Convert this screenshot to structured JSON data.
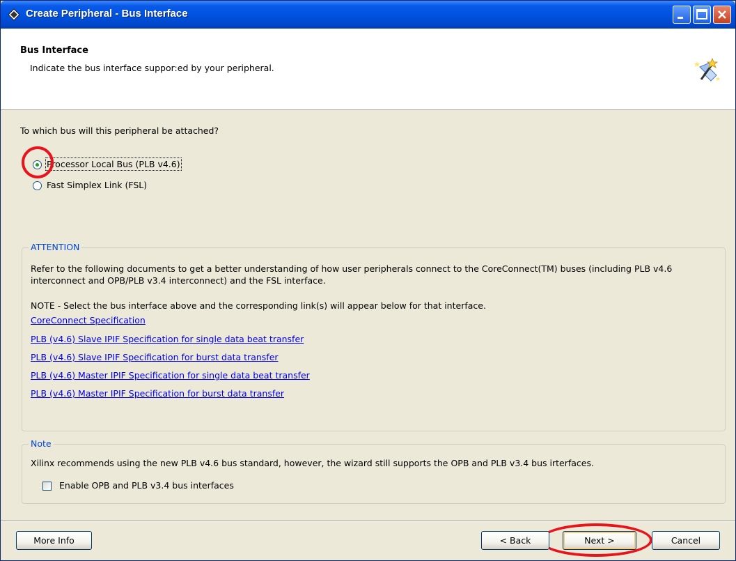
{
  "window": {
    "title": "Create Peripheral - Bus Interface"
  },
  "header": {
    "title": "Bus Interface",
    "subtitle": "Indicate the bus interface suppor:ed by your peripheral."
  },
  "question": "To which bus will this peripheral be attached?",
  "bus_options": [
    {
      "label": "Processor Local Bus (PLB v4.6)",
      "selected": true
    },
    {
      "label": "Fast Simplex Link (FSL)",
      "selected": false
    }
  ],
  "attention": {
    "title": "ATTENTION",
    "text": "Refer to the following documents to get a better understanding of how user peripherals connect to the CoreConnect(TM) buses (including PLB v4.6 interconnect and OPB/PLB v3.4 interconnect) and the FSL interface.",
    "note": "NOTE - Select the bus interface above and the corresponding link(s) will appear below for that interface.",
    "links": [
      "CoreConnect Specification",
      "PLB (v4.6) Slave IPIF Specification for single data beat transfer",
      "PLB (v4.6) Slave IPIF Specification for burst data transfer",
      "PLB (v4.6) Master IPIF Specification for single data beat transfer",
      "PLB (v4.6) Master IPIF Specification for burst data transfer"
    ]
  },
  "note_group": {
    "title": "Note",
    "text": "Xilinx recommends using the new PLB v4.6 bus standard, however, the wizard still supports the OPB and PLB v3.4 bus irterfaces.",
    "checkbox_label": "Enable OPB and PLB v3.4 bus interfaces",
    "checkbox_checked": false
  },
  "buttons": {
    "more_info": "More Info",
    "back": "< Back",
    "next": "Next >",
    "cancel": "Cancel"
  },
  "colors": {
    "titlebar": "#0052e0",
    "group_title": "#0046d5",
    "link": "#0000ee",
    "annotation_red": "#e8141c"
  }
}
